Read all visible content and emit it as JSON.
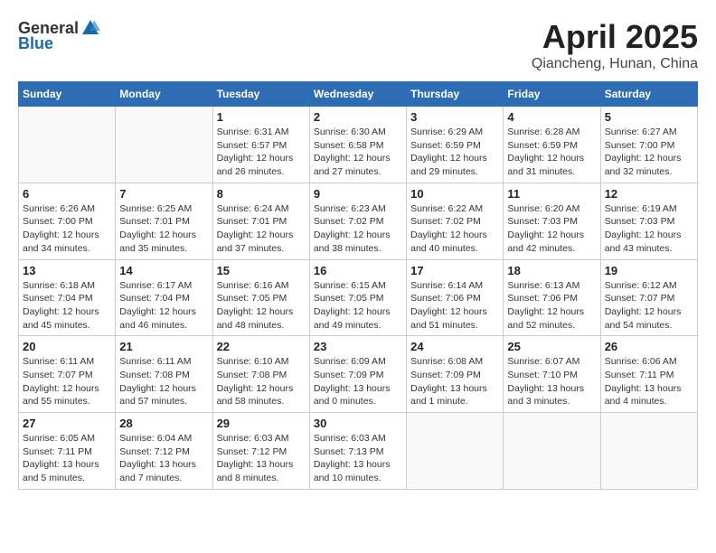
{
  "header": {
    "logo_general": "General",
    "logo_blue": "Blue",
    "month_year": "April 2025",
    "location": "Qiancheng, Hunan, China"
  },
  "columns": [
    "Sunday",
    "Monday",
    "Tuesday",
    "Wednesday",
    "Thursday",
    "Friday",
    "Saturday"
  ],
  "weeks": [
    [
      {
        "day": "",
        "info": ""
      },
      {
        "day": "",
        "info": ""
      },
      {
        "day": "1",
        "info": "Sunrise: 6:31 AM\nSunset: 6:57 PM\nDaylight: 12 hours\nand 26 minutes."
      },
      {
        "day": "2",
        "info": "Sunrise: 6:30 AM\nSunset: 6:58 PM\nDaylight: 12 hours\nand 27 minutes."
      },
      {
        "day": "3",
        "info": "Sunrise: 6:29 AM\nSunset: 6:59 PM\nDaylight: 12 hours\nand 29 minutes."
      },
      {
        "day": "4",
        "info": "Sunrise: 6:28 AM\nSunset: 6:59 PM\nDaylight: 12 hours\nand 31 minutes."
      },
      {
        "day": "5",
        "info": "Sunrise: 6:27 AM\nSunset: 7:00 PM\nDaylight: 12 hours\nand 32 minutes."
      }
    ],
    [
      {
        "day": "6",
        "info": "Sunrise: 6:26 AM\nSunset: 7:00 PM\nDaylight: 12 hours\nand 34 minutes."
      },
      {
        "day": "7",
        "info": "Sunrise: 6:25 AM\nSunset: 7:01 PM\nDaylight: 12 hours\nand 35 minutes."
      },
      {
        "day": "8",
        "info": "Sunrise: 6:24 AM\nSunset: 7:01 PM\nDaylight: 12 hours\nand 37 minutes."
      },
      {
        "day": "9",
        "info": "Sunrise: 6:23 AM\nSunset: 7:02 PM\nDaylight: 12 hours\nand 38 minutes."
      },
      {
        "day": "10",
        "info": "Sunrise: 6:22 AM\nSunset: 7:02 PM\nDaylight: 12 hours\nand 40 minutes."
      },
      {
        "day": "11",
        "info": "Sunrise: 6:20 AM\nSunset: 7:03 PM\nDaylight: 12 hours\nand 42 minutes."
      },
      {
        "day": "12",
        "info": "Sunrise: 6:19 AM\nSunset: 7:03 PM\nDaylight: 12 hours\nand 43 minutes."
      }
    ],
    [
      {
        "day": "13",
        "info": "Sunrise: 6:18 AM\nSunset: 7:04 PM\nDaylight: 12 hours\nand 45 minutes."
      },
      {
        "day": "14",
        "info": "Sunrise: 6:17 AM\nSunset: 7:04 PM\nDaylight: 12 hours\nand 46 minutes."
      },
      {
        "day": "15",
        "info": "Sunrise: 6:16 AM\nSunset: 7:05 PM\nDaylight: 12 hours\nand 48 minutes."
      },
      {
        "day": "16",
        "info": "Sunrise: 6:15 AM\nSunset: 7:05 PM\nDaylight: 12 hours\nand 49 minutes."
      },
      {
        "day": "17",
        "info": "Sunrise: 6:14 AM\nSunset: 7:06 PM\nDaylight: 12 hours\nand 51 minutes."
      },
      {
        "day": "18",
        "info": "Sunrise: 6:13 AM\nSunset: 7:06 PM\nDaylight: 12 hours\nand 52 minutes."
      },
      {
        "day": "19",
        "info": "Sunrise: 6:12 AM\nSunset: 7:07 PM\nDaylight: 12 hours\nand 54 minutes."
      }
    ],
    [
      {
        "day": "20",
        "info": "Sunrise: 6:11 AM\nSunset: 7:07 PM\nDaylight: 12 hours\nand 55 minutes."
      },
      {
        "day": "21",
        "info": "Sunrise: 6:11 AM\nSunset: 7:08 PM\nDaylight: 12 hours\nand 57 minutes."
      },
      {
        "day": "22",
        "info": "Sunrise: 6:10 AM\nSunset: 7:08 PM\nDaylight: 12 hours\nand 58 minutes."
      },
      {
        "day": "23",
        "info": "Sunrise: 6:09 AM\nSunset: 7:09 PM\nDaylight: 13 hours\nand 0 minutes."
      },
      {
        "day": "24",
        "info": "Sunrise: 6:08 AM\nSunset: 7:09 PM\nDaylight: 13 hours\nand 1 minute."
      },
      {
        "day": "25",
        "info": "Sunrise: 6:07 AM\nSunset: 7:10 PM\nDaylight: 13 hours\nand 3 minutes."
      },
      {
        "day": "26",
        "info": "Sunrise: 6:06 AM\nSunset: 7:11 PM\nDaylight: 13 hours\nand 4 minutes."
      }
    ],
    [
      {
        "day": "27",
        "info": "Sunrise: 6:05 AM\nSunset: 7:11 PM\nDaylight: 13 hours\nand 5 minutes."
      },
      {
        "day": "28",
        "info": "Sunrise: 6:04 AM\nSunset: 7:12 PM\nDaylight: 13 hours\nand 7 minutes."
      },
      {
        "day": "29",
        "info": "Sunrise: 6:03 AM\nSunset: 7:12 PM\nDaylight: 13 hours\nand 8 minutes."
      },
      {
        "day": "30",
        "info": "Sunrise: 6:03 AM\nSunset: 7:13 PM\nDaylight: 13 hours\nand 10 minutes."
      },
      {
        "day": "",
        "info": ""
      },
      {
        "day": "",
        "info": ""
      },
      {
        "day": "",
        "info": ""
      }
    ]
  ]
}
